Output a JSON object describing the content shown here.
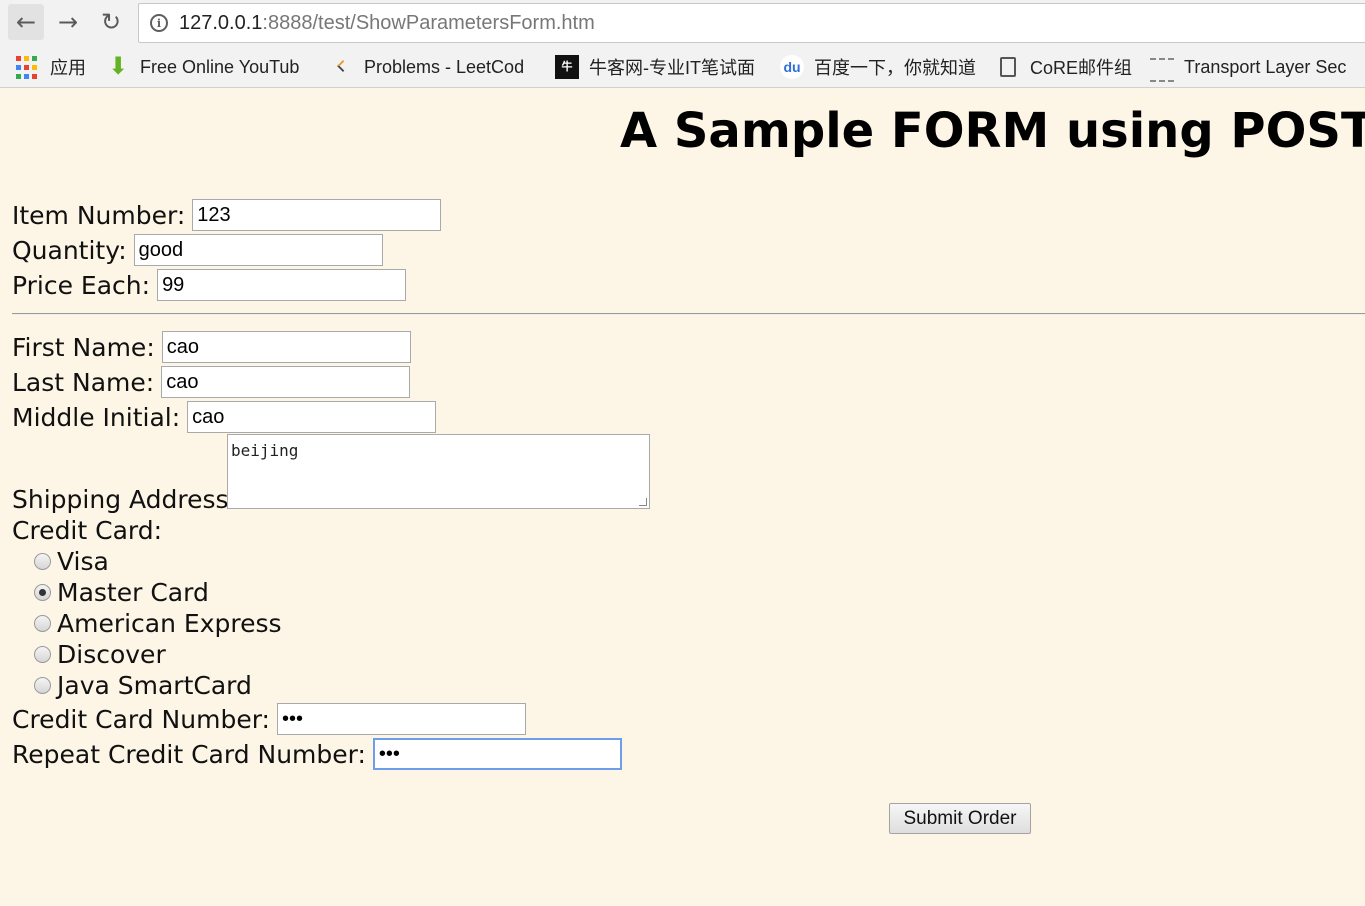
{
  "browser": {
    "url_host": "127.0.0.1",
    "url_path": ":8888/test/ShowParametersForm.htm",
    "bookmarks": [
      {
        "label": "应用",
        "icon": "apps-grid-icon"
      },
      {
        "label": "Free Online YouTub",
        "icon": "download-arrow-icon"
      },
      {
        "label": "Problems - LeetCod",
        "icon": "leetcode-icon"
      },
      {
        "label": "牛客网-专业IT笔试面",
        "icon": "nowcoder-icon"
      },
      {
        "label": "百度一下，你就知道",
        "icon": "baidu-paw-icon"
      },
      {
        "label": "CoRE邮件组",
        "icon": "document-icon"
      },
      {
        "label": "Transport Layer Sec",
        "icon": "tls-icon"
      }
    ]
  },
  "page": {
    "title": "A Sample FORM using POST",
    "fields": {
      "item_number": {
        "label": "Item Number:",
        "value": "123"
      },
      "quantity": {
        "label": "Quantity:",
        "value": "good"
      },
      "price_each": {
        "label": "Price Each:",
        "value": "99"
      },
      "first_name": {
        "label": "First Name:",
        "value": "cao"
      },
      "last_name": {
        "label": "Last Name:",
        "value": "cao"
      },
      "middle_initial": {
        "label": "Middle Initial:",
        "value": "cao"
      },
      "shipping_address": {
        "label": "Shipping Address:",
        "value": "beijing"
      },
      "credit_card_number": {
        "label": "Credit Card Number:",
        "value": "•••"
      },
      "repeat_credit_card_number": {
        "label": "Repeat Credit Card Number:",
        "value": "•••"
      }
    },
    "credit_card": {
      "label": "Credit Card:",
      "options": [
        "Visa",
        "Master Card",
        "American Express",
        "Discover",
        "Java SmartCard"
      ],
      "selected": "Master Card"
    },
    "submit_label": "Submit Order"
  },
  "colors": {
    "page_background": "#fdf5e6",
    "focus_ring": "#6d9eeb"
  }
}
